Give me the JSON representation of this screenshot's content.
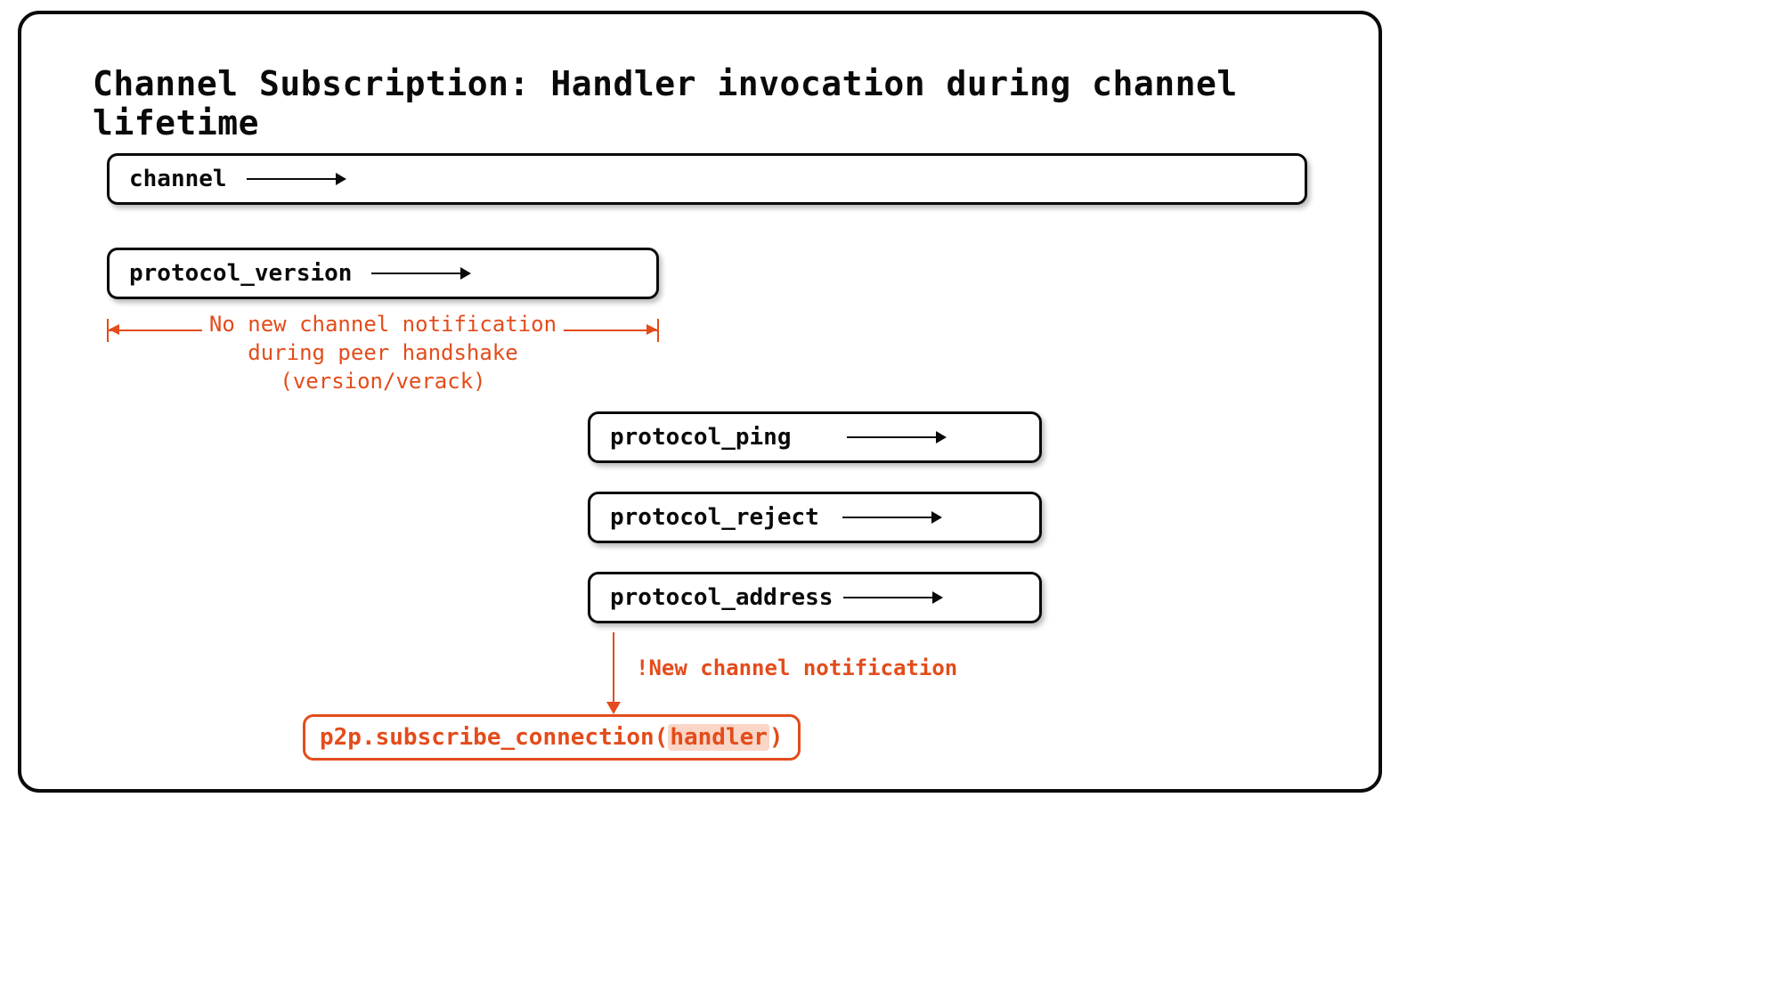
{
  "title": "Channel Subscription: Handler invocation during channel lifetime",
  "boxes": {
    "channel": {
      "label": "channel"
    },
    "protocol_version": {
      "label": "protocol_version"
    },
    "protocol_ping": {
      "label": "protocol_ping"
    },
    "protocol_reject": {
      "label": "protocol_reject"
    },
    "protocol_address": {
      "label": "protocol_address"
    }
  },
  "span_note": {
    "line1": "No new channel notification",
    "line2": "during peer handshake",
    "line3": "(version/verack)"
  },
  "new_channel_note": "!New channel notification",
  "subscribe": {
    "prefix": "p2p.subscribe_connection(",
    "highlight": "handler",
    "suffix": ")"
  },
  "colors": {
    "accent": "#e34c1b"
  }
}
